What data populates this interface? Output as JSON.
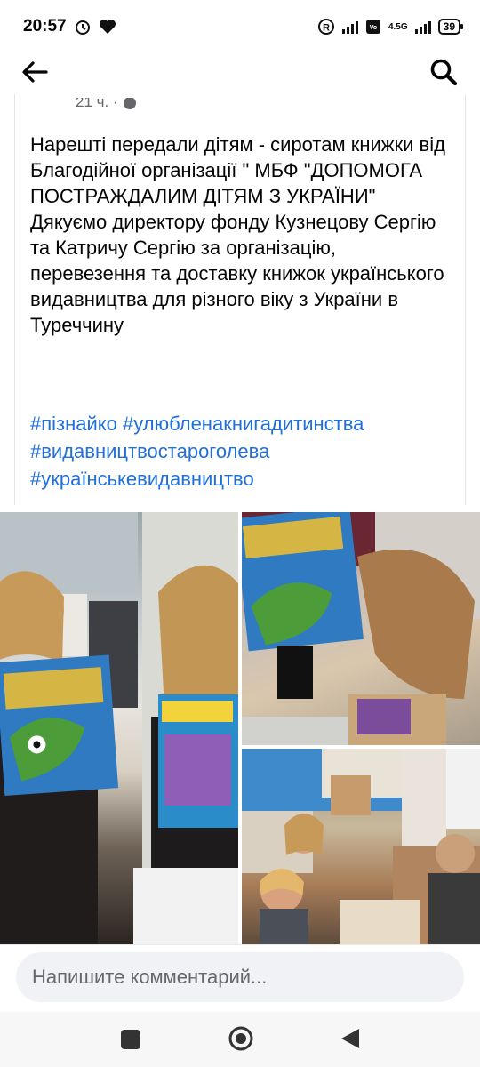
{
  "status_bar": {
    "time": "20:57",
    "network": "4.5G",
    "battery": "39",
    "icons": [
      "alarm-icon",
      "heart-icon",
      "registered-icon",
      "signal-icon",
      "volte-icon",
      "battery-icon"
    ]
  },
  "app_bar": {
    "back_icon": "arrow-left-icon",
    "search_icon": "search-icon"
  },
  "post": {
    "meta": "21 ч. ·",
    "body": "Нарешті передали дітям - сиротам книжки від Благодійної організації \" МБФ \"ДОПОМОГА ПОСТРАЖДАЛИМ ДІТЯМ З УКРАЇНИ\"\nДякуємо директору фонду Кузнецову Сергію та Катричу Сергію за організацію, перевезення та доставку книжок українського видавництва для різного віку з України в Туреччину",
    "hashtags": [
      "#пізнайко",
      "#улюбленакнигадитинства",
      "#видавництвостароголева",
      "#українськевидавництво"
    ]
  },
  "photos": [
    {
      "alt": ""
    },
    {
      "alt": ""
    },
    {
      "alt": ""
    }
  ],
  "comment": {
    "placeholder": "Напишите комментарий..."
  },
  "nav_bar": {
    "icons": [
      "recent-apps-icon",
      "home-icon",
      "back-triangle-icon"
    ]
  },
  "colors": {
    "link": "#216fdb",
    "input_bg": "#f0f2f5",
    "text": "#050505",
    "muted": "#65676b"
  }
}
